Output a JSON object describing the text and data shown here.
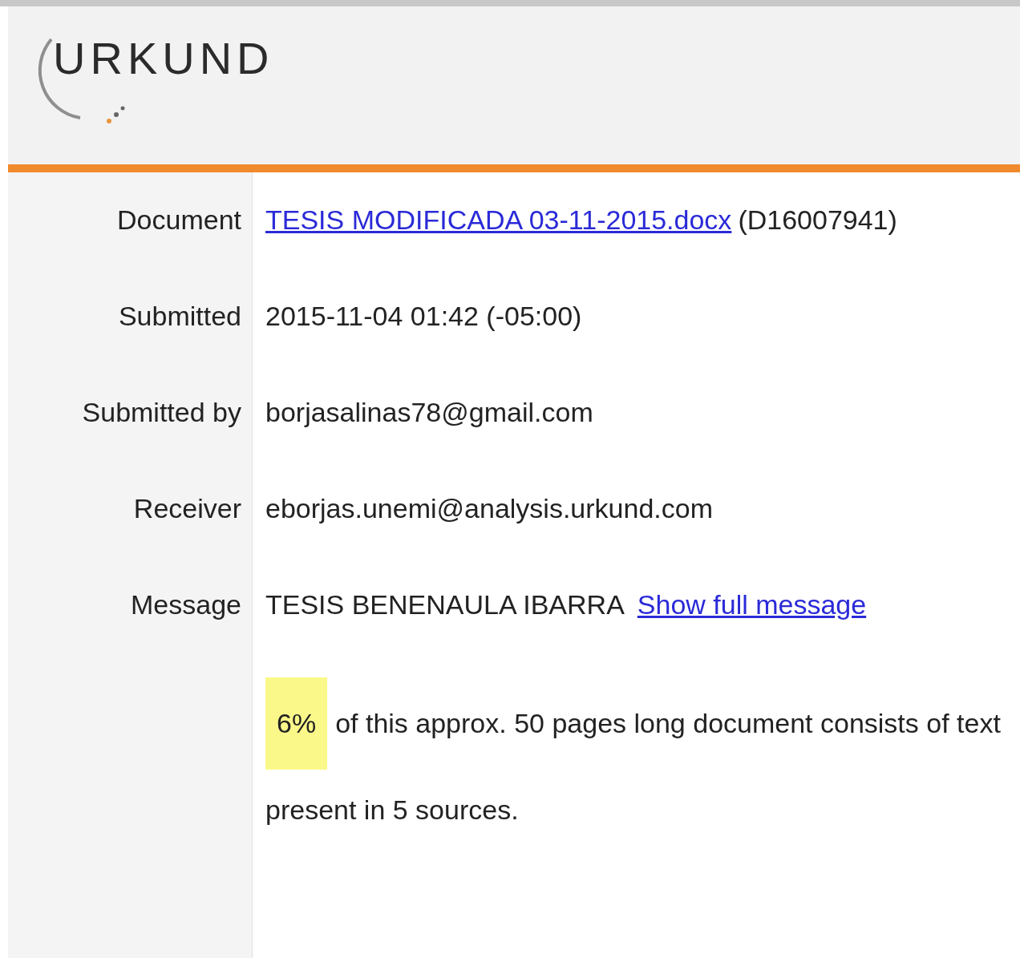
{
  "header": {
    "logo": "URKUND"
  },
  "details": [
    {
      "kind": "link_text",
      "label": "Document",
      "link": "TESIS MODIFICADA 03-11-2015.docx",
      "value": "(D16007941)"
    },
    {
      "kind": "text",
      "label": "Submitted",
      "value": "2015-11-04 01:42 (-05:00)"
    },
    {
      "kind": "text",
      "label": "Submitted by",
      "value": "borjasalinas78@gmail.com"
    },
    {
      "kind": "text",
      "label": "Receiver",
      "value": "eborjas.unemi@analysis.urkund.com"
    },
    {
      "kind": "text_link",
      "label": "Message",
      "value": "TESIS BENENAULA IBARRA",
      "link": "Show full message"
    }
  ],
  "summary": {
    "percentage": "6%",
    "text": "of this approx. 50 pages long document consists of text present in 5 sources."
  }
}
